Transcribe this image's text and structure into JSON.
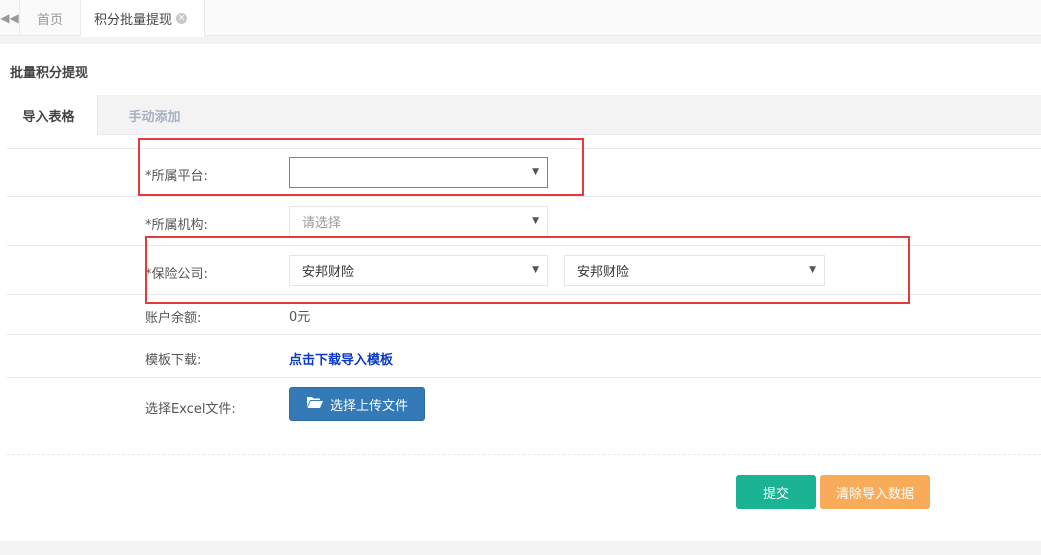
{
  "tabbar": {
    "prev_icon": "double-left-arrow-icon",
    "tabs": [
      {
        "label": "首页"
      },
      {
        "label": "积分批量提现",
        "close_icon": "close-circle-icon"
      }
    ]
  },
  "page": {
    "title": "批量积分提现",
    "subtabs": [
      {
        "label": "导入表格"
      },
      {
        "label": "手动添加"
      }
    ]
  },
  "form": {
    "platform": {
      "label": "*所属平台:",
      "value": ""
    },
    "organization": {
      "label": "*所属机构:",
      "placeholder": "请选择"
    },
    "insurer": {
      "label": "*保险公司:",
      "value1": "安邦财险",
      "value2": "安邦财险"
    },
    "balance": {
      "label": "账户余额:",
      "value": "0元"
    },
    "template": {
      "label": "模板下载:",
      "link": "点击下载导入模板"
    },
    "excel": {
      "label": "选择Excel文件:",
      "button": "选择上传文件",
      "button_icon": "folder-open-icon"
    }
  },
  "actions": {
    "submit": "提交",
    "clear": "清除导入数据"
  },
  "colors": {
    "accent_green": "#1ab394",
    "primary_blue": "#337ab7",
    "warning_orange": "#f8ac59",
    "link_blue": "#0a39c8",
    "annotation_red": "#e43a3a"
  }
}
